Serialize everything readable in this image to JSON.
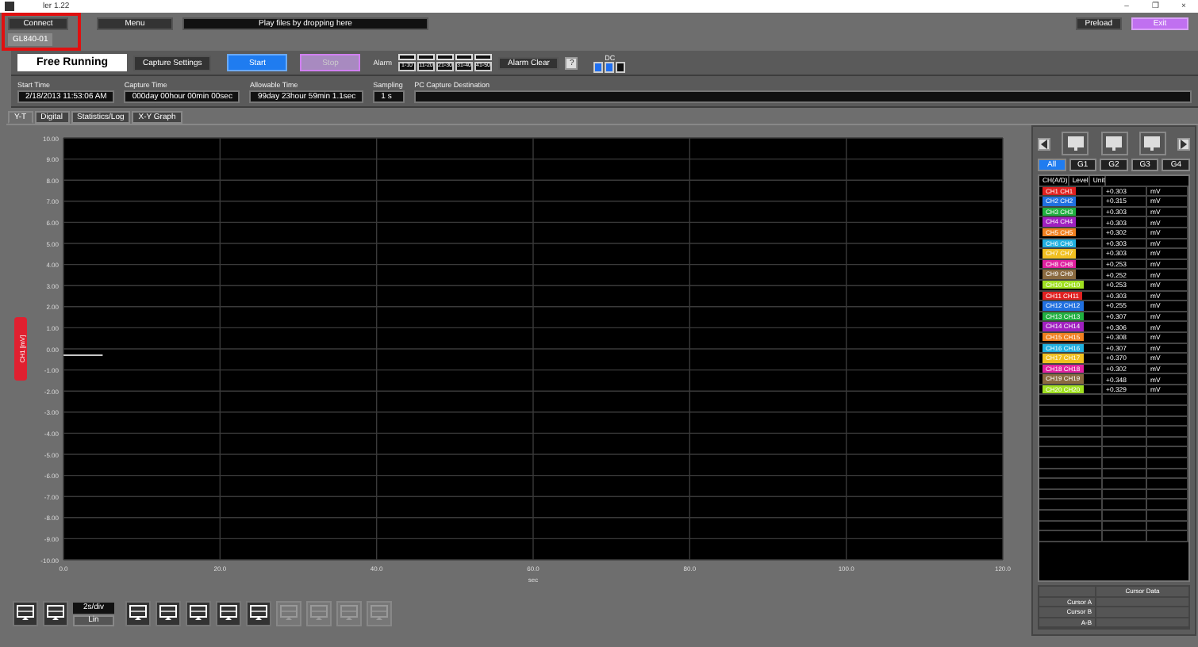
{
  "window": {
    "title": "ler 1.22",
    "controls": [
      "–",
      "❐",
      "×"
    ]
  },
  "top_bar": {
    "connect": "Connect",
    "device_tab": "GL840-01",
    "highlighted": true,
    "menu": "Menu",
    "drop_field": "Play files by dropping here",
    "preload": "Preload",
    "exit": "Exit"
  },
  "control_bar": {
    "mode": "Free Running",
    "capture_settings": "Capture Settings",
    "start": "Start",
    "stop": "Stop",
    "stop_disabled": true,
    "alarm_label": "Alarm",
    "alarms": [
      {
        "label": "1-10",
        "on": false
      },
      {
        "label": "11-20",
        "on": false
      },
      {
        "label": "21-30",
        "on": false
      },
      {
        "label": "31-40",
        "on": false
      },
      {
        "label": "41-50",
        "on": false
      }
    ],
    "alarm_clear": "Alarm Clear",
    "help": "?",
    "dc_label": "DC",
    "dc": [
      {
        "on": true
      },
      {
        "on": true
      },
      {
        "on": false
      }
    ]
  },
  "status": [
    {
      "label": "Start Time",
      "value": "2/18/2013 11:53:06 AM"
    },
    {
      "label": "Capture Time",
      "value": "000day 00hour 00min 00sec"
    },
    {
      "label": "Allowable Time",
      "value": "99day 23hour 59min 1.1sec"
    },
    {
      "label": "Sampling",
      "value": "1 s"
    },
    {
      "label": "PC Capture Destination"
    }
  ],
  "tabs": [
    {
      "label": "Y-T",
      "selected": true
    },
    {
      "label": "Digital",
      "selected": false
    },
    {
      "label": "Statistics/Log",
      "selected": false
    },
    {
      "label": "X-Y Graph",
      "selected": false
    }
  ],
  "chart": {
    "chart_data": {
      "type": "line",
      "xlabel": "sec",
      "ylabel": "CH1 [mV]",
      "xlim": [
        0,
        120
      ],
      "ylim": [
        -10,
        10
      ],
      "xticks": [
        {
          "value": 0,
          "label": "0.0"
        },
        {
          "value": 20,
          "label": "20.0"
        },
        {
          "value": 40,
          "label": "40.0"
        },
        {
          "value": 60,
          "label": "60.0"
        },
        {
          "value": 80,
          "label": "80.0"
        },
        {
          "value": 100,
          "label": "100.0"
        },
        {
          "value": 120,
          "label": "120.0"
        }
      ],
      "yticks": [
        {
          "value": 10,
          "label": "10.00"
        },
        {
          "value": 9,
          "label": "9.00"
        },
        {
          "value": 8,
          "label": "8.00"
        },
        {
          "value": 7,
          "label": "7.00"
        },
        {
          "value": 6,
          "label": "6.00"
        },
        {
          "value": 5,
          "label": "5.00"
        },
        {
          "value": 4,
          "label": "4.00"
        },
        {
          "value": 3,
          "label": "3.00"
        },
        {
          "value": 2,
          "label": "2.00"
        },
        {
          "value": 1,
          "label": "1.00"
        },
        {
          "value": 0,
          "label": "0.00"
        },
        {
          "value": -1,
          "label": "-1.00"
        },
        {
          "value": -2,
          "label": "-2.00"
        },
        {
          "value": -3,
          "label": "-3.00"
        },
        {
          "value": -4,
          "label": "-4.00"
        },
        {
          "value": -5,
          "label": "-5.00"
        },
        {
          "value": -6,
          "label": "-6.00"
        },
        {
          "value": -7,
          "label": "-7.00"
        },
        {
          "value": -8,
          "label": "-8.00"
        },
        {
          "value": -9,
          "label": "-9.00"
        },
        {
          "value": -10,
          "label": "-10.00"
        }
      ],
      "grid": true,
      "x": [
        0,
        5
      ],
      "series": [
        {
          "color": "#c8c8c8",
          "values": [
            -0.3,
            -0.3
          ]
        }
      ]
    }
  },
  "toolbar": [
    {
      "kind": "button",
      "disabled": false
    },
    {
      "kind": "button",
      "disabled": false
    },
    {
      "kind": "scale",
      "value": "2s/div",
      "mode": "Lin"
    },
    {
      "kind": "button",
      "disabled": false
    },
    {
      "kind": "button",
      "disabled": false
    },
    {
      "kind": "button",
      "disabled": false
    },
    {
      "kind": "button",
      "disabled": false
    },
    {
      "kind": "button",
      "disabled": false
    },
    {
      "kind": "button",
      "disabled": true
    },
    {
      "kind": "button",
      "disabled": true
    },
    {
      "kind": "button",
      "disabled": true
    },
    {
      "kind": "button",
      "disabled": true
    }
  ],
  "side_panel": {
    "groups": [
      {
        "label": "All",
        "selected": true
      },
      {
        "label": "G1",
        "selected": false
      },
      {
        "label": "G2",
        "selected": false
      },
      {
        "label": "G3",
        "selected": false
      },
      {
        "label": "G4",
        "selected": false
      }
    ],
    "columns": [
      "CH(A/D)",
      "Level",
      "Unit"
    ],
    "rows": [
      {
        "channel": "CH1  CH1",
        "level": "+0.303",
        "unit": "mV",
        "color": "#e02020"
      },
      {
        "channel": "CH2  CH2",
        "level": "+0.315",
        "unit": "mV",
        "color": "#2070e0"
      },
      {
        "channel": "CH3  CH3",
        "level": "+0.303",
        "unit": "mV",
        "color": "#20b040"
      },
      {
        "channel": "CH4  CH4",
        "level": "+0.303",
        "unit": "mV",
        "color": "#a020c0"
      },
      {
        "channel": "CH5  CH5",
        "level": "+0.302",
        "unit": "mV",
        "color": "#f08020"
      },
      {
        "channel": "CH6  CH6",
        "level": "+0.303",
        "unit": "mV",
        "color": "#20b0e0"
      },
      {
        "channel": "CH7  CH7",
        "level": "+0.303",
        "unit": "mV",
        "color": "#f0c020"
      },
      {
        "channel": "CH8  CH8",
        "level": "+0.253",
        "unit": "mV",
        "color": "#e020a0"
      },
      {
        "channel": "CH9  CH9",
        "level": "+0.252",
        "unit": "mV",
        "color": "#8a6a40"
      },
      {
        "channel": "CH10 CH10",
        "level": "+0.253",
        "unit": "mV",
        "color": "#a0e020"
      },
      {
        "channel": "CH11 CH11",
        "level": "+0.303",
        "unit": "mV",
        "color": "#e02020"
      },
      {
        "channel": "CH12 CH12",
        "level": "+0.255",
        "unit": "mV",
        "color": "#2070e0"
      },
      {
        "channel": "CH13 CH13",
        "level": "+0.307",
        "unit": "mV",
        "color": "#20b040"
      },
      {
        "channel": "CH14 CH14",
        "level": "+0.306",
        "unit": "mV",
        "color": "#a020c0"
      },
      {
        "channel": "CH15 CH15",
        "level": "+0.308",
        "unit": "mV",
        "color": "#f08020"
      },
      {
        "channel": "CH16 CH16",
        "level": "+0.307",
        "unit": "mV",
        "color": "#20b0e0"
      },
      {
        "channel": "CH17 CH17",
        "level": "+0.370",
        "unit": "mV",
        "color": "#f0c020"
      },
      {
        "channel": "CH18 CH18",
        "level": "+0.302",
        "unit": "mV",
        "color": "#e020a0"
      },
      {
        "channel": "CH19 CH19",
        "level": "+0.348",
        "unit": "mV",
        "color": "#8a6a40"
      },
      {
        "channel": "CH20 CH20",
        "level": "+0.329",
        "unit": "mV",
        "color": "#a0e020"
      }
    ],
    "cursor_table": {
      "header": "Cursor Data",
      "rows": [
        "Cursor A",
        "Cursor B",
        "A-B"
      ]
    }
  }
}
